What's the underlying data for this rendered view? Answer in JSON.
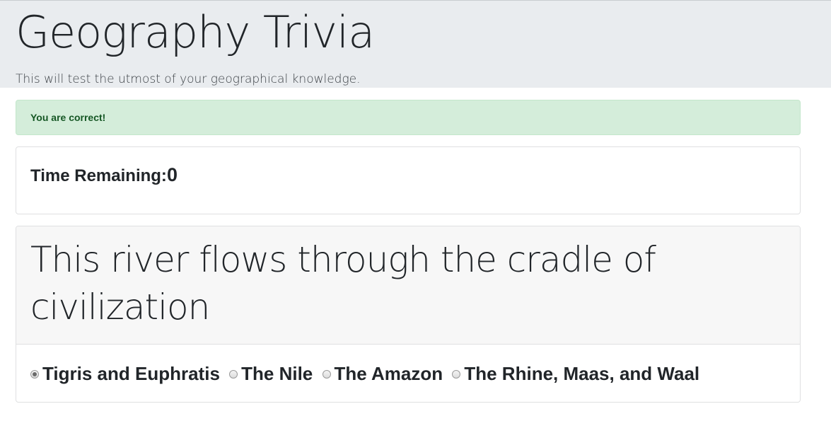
{
  "header": {
    "title": "Geography Trivia",
    "subtitle": "This will test the utmost of your geographical knowledge."
  },
  "alert": {
    "message": "You are correct!",
    "color": "#d4edda"
  },
  "timer": {
    "label": "Time Remaining:",
    "value": "0"
  },
  "question": {
    "text": "This river flows through the cradle of civilization",
    "answers": [
      {
        "label": "Tigris and Euphratis",
        "selected": true
      },
      {
        "label": "The Nile",
        "selected": false
      },
      {
        "label": "The Amazon",
        "selected": false
      },
      {
        "label": "The Rhine, Maas, and Waal",
        "selected": false
      }
    ]
  }
}
